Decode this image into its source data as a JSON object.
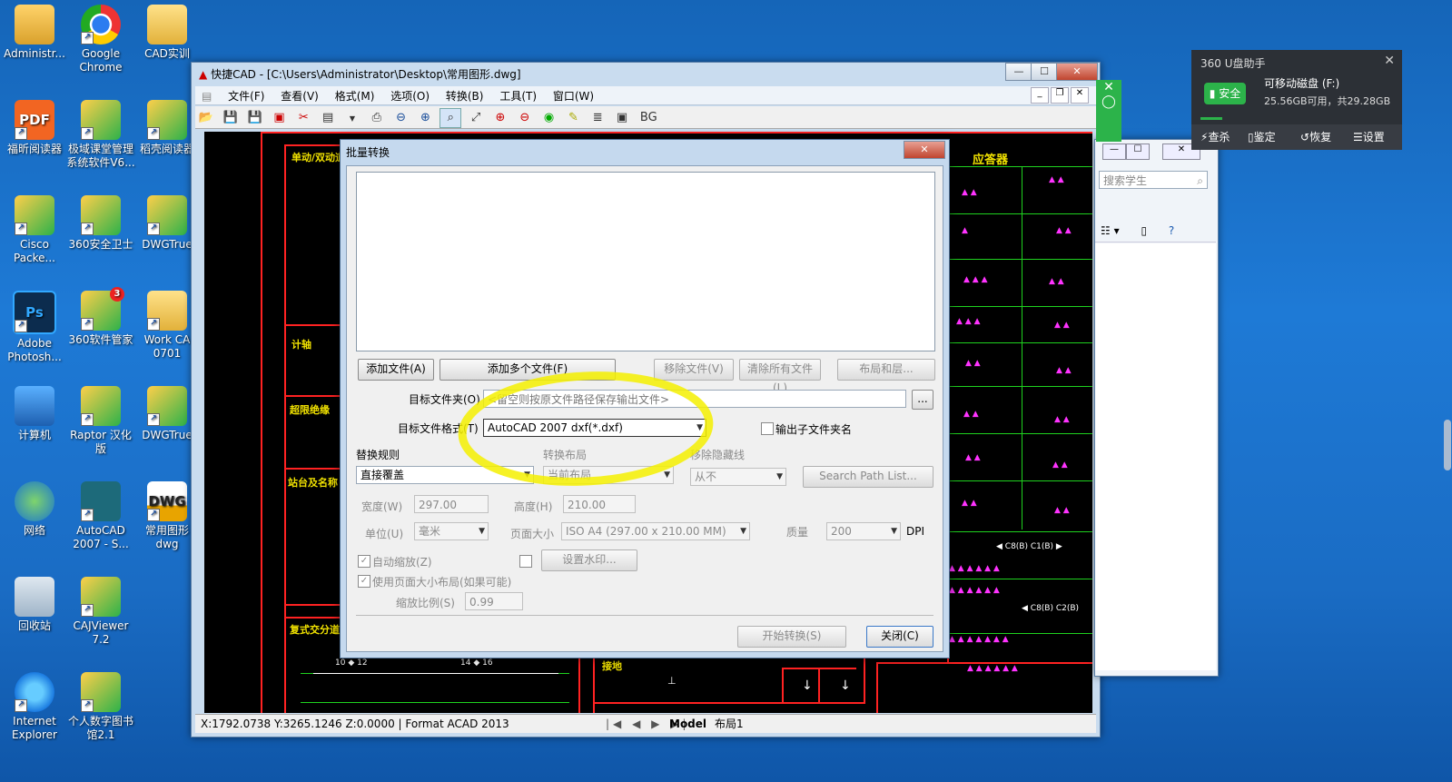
{
  "desktop": {
    "icons": [
      {
        "label": "Administr...",
        "type": "user"
      },
      {
        "label": "Google Chrome",
        "type": "chrome"
      },
      {
        "label": "CAD实训",
        "type": "folder"
      },
      {
        "label": "福昕阅读器",
        "type": "pdf"
      },
      {
        "label": "极域课堂管理系统软件V6...",
        "type": "app"
      },
      {
        "label": "稻壳阅读器",
        "type": "app"
      },
      {
        "label": "Cisco Packe...",
        "type": "app"
      },
      {
        "label": "360安全卫士",
        "type": "app"
      },
      {
        "label": "DWGTrue",
        "type": "app"
      },
      {
        "label": "Adobe Photosh...",
        "type": "ps"
      },
      {
        "label": "360软件管家",
        "type": "app"
      },
      {
        "label": "Work CA 0701",
        "type": "folder"
      },
      {
        "label": "计算机",
        "type": "computer"
      },
      {
        "label": "Raptor 汉化版",
        "type": "app"
      },
      {
        "label": "DWGTrue",
        "type": "app"
      },
      {
        "label": "网络",
        "type": "network"
      },
      {
        "label": "AutoCAD 2007 - S...",
        "type": "acad"
      },
      {
        "label": "常用图形 dwg",
        "type": "dwg"
      },
      {
        "label": "回收站",
        "type": "recycle"
      },
      {
        "label": "CAJViewer 7.2",
        "type": "app"
      },
      {
        "label": "Internet Explorer",
        "type": "ie"
      },
      {
        "label": "个人数字图书馆2.1",
        "type": "app"
      }
    ],
    "badge_360": "3",
    "icon_ps": "Ps",
    "icon_pdf": "PDF",
    "icon_dwg": "DWG"
  },
  "cad_window": {
    "title": "快捷CAD - [C:\\Users\\Administrator\\Desktop\\常用图形.dwg]",
    "menus": [
      "文件(F)",
      "查看(V)",
      "格式(M)",
      "选项(O)",
      "转换(B)",
      "工具(T)",
      "窗口(W)"
    ],
    "toolbar_bg_label": "BG",
    "status_text": "X:1792.0738 Y:3265.1246 Z:0.0000 | Format ACAD 2013",
    "tabs": [
      "Model",
      "布局1"
    ],
    "drawing_labels": {
      "l1": "单动/双动道",
      "l2": "计轴",
      "l3": "超限绝缘",
      "l4": "站台及名称",
      "l5": "复式交分道岔",
      "l6": "接地",
      "l7": "应答器"
    }
  },
  "dialog": {
    "title": "批量转换",
    "add_file": "添加文件(A)",
    "add_many": "添加多个文件(F)",
    "remove_file": "移除文件(V)",
    "clear_all": "清除所有文件(L)",
    "layout_layers": "布局和层...",
    "target_folder_label": "目标文件夹(O)",
    "target_folder_placeholder": "<留空则按原文件路径保存输出文件>",
    "browse": "...",
    "target_format_label": "目标文件格式(T)",
    "target_format_value": "AutoCAD 2007 dxf(*.dxf)",
    "output_subfolder": "输出子文件夹名",
    "replace_rule_label": "替换规则",
    "replace_rule_value": "直接覆盖",
    "convert_layout_label": "转换布局",
    "convert_layout_value": "当前布局",
    "remove_hidden_label": "移除隐藏线",
    "remove_hidden_value": "从不",
    "search_path": "Search Path List...",
    "width_label": "宽度(W)",
    "width_value": "297.00",
    "height_label": "高度(H)",
    "height_value": "210.00",
    "unit_label": "单位(U)",
    "unit_value": "毫米",
    "page_size_label": "页面大小",
    "page_size_value": "ISO A4 (297.00 x 210.00 MM)",
    "quality_label": "质量",
    "quality_value": "200",
    "dpi": "DPI",
    "auto_zoom": "自动缩放(Z)",
    "watermark": "设置水印...",
    "use_page_layout": "使用页面大小布局(如果可能)",
    "scale_label": "缩放比例(S)",
    "scale_value": "0.99",
    "start": "开始转换(S)",
    "close": "关闭(C)",
    "check_mark": "✓"
  },
  "u360": {
    "title": "360 U盘助手",
    "safe": "安全",
    "drive": "可移动磁盘 (F:)",
    "space": "25.56GB可用，共29.28GB",
    "actions": [
      "查杀",
      "鉴定",
      "恢复",
      "设置"
    ]
  },
  "explorer": {
    "search_placeholder": "搜索学生"
  },
  "colors": {
    "highlight": "#f5f000",
    "cad_red": "#ff2222",
    "cad_green": "#1fd21f"
  }
}
